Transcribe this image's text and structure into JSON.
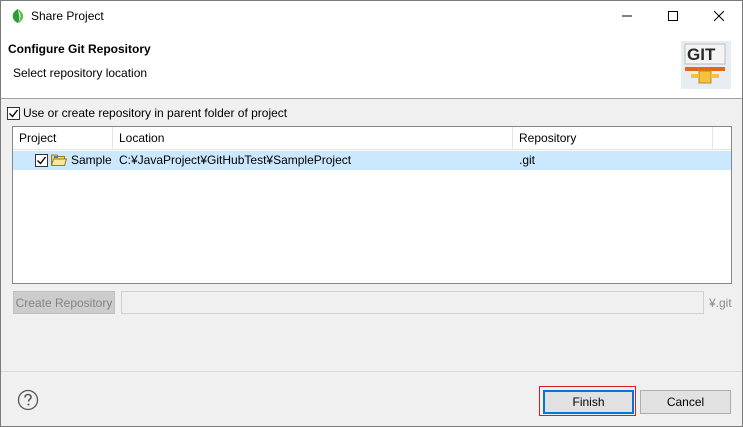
{
  "window": {
    "title": "Share Project",
    "minimize_glyph": "minimize-icon",
    "maximize_glyph": "maximize-icon",
    "close_glyph": "close-icon"
  },
  "header": {
    "title": "Configure Git Repository",
    "subtitle": "Select repository location",
    "logo_text": "GIT"
  },
  "options": {
    "use_parent_label": "Use or create repository in parent folder of project",
    "use_parent_checked": true
  },
  "table": {
    "columns": [
      "Project",
      "Location",
      "Repository"
    ],
    "rows": [
      {
        "checked": true,
        "project": "SampleProject",
        "location": "C:¥JavaProject¥GitHubTest¥SampleProject",
        "repository": ".git"
      }
    ]
  },
  "repository_controls": {
    "create_label": "Create Repository",
    "path_value": "",
    "git_suffix": "¥.git"
  },
  "footer": {
    "finish_label": "Finish",
    "cancel_label": "Cancel"
  },
  "colors": {
    "selection": "#cce8ff",
    "focus_border": "#0078d7",
    "highlight_outline": "#d81e1e"
  }
}
